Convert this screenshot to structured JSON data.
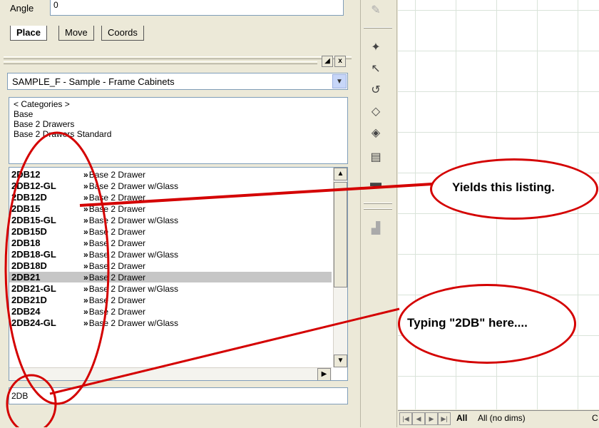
{
  "top": {
    "angle_label": "Angle",
    "angle_value": "0"
  },
  "tabs": [
    {
      "label": "Place",
      "active": true
    },
    {
      "label": "Move",
      "active": false
    },
    {
      "label": "Coords",
      "active": false
    }
  ],
  "panel_controls": {
    "pin": "◢",
    "close": "x"
  },
  "catalog": {
    "selected": "SAMPLE_F - Sample - Frame Cabinets"
  },
  "categories": [
    "< Categories >",
    "Base",
    "Base 2 Drawers",
    "Base 2 Drawers Standard"
  ],
  "list": {
    "rows": [
      {
        "code": "2DB12",
        "desc": "Base 2 Drawer"
      },
      {
        "code": "2DB12-GL",
        "desc": "Base 2 Drawer w/Glass"
      },
      {
        "code": "2DB12D",
        "desc": "Base 2 Drawer"
      },
      {
        "code": "2DB15",
        "desc": "Base 2 Drawer"
      },
      {
        "code": "2DB15-GL",
        "desc": "Base 2 Drawer w/Glass"
      },
      {
        "code": "2DB15D",
        "desc": "Base 2 Drawer"
      },
      {
        "code": "2DB18",
        "desc": "Base 2 Drawer"
      },
      {
        "code": "2DB18-GL",
        "desc": "Base 2 Drawer w/Glass"
      },
      {
        "code": "2DB18D",
        "desc": "Base 2 Drawer"
      },
      {
        "code": "2DB21",
        "desc": "Base 2 Drawer",
        "selected": true
      },
      {
        "code": "2DB21-GL",
        "desc": "Base 2 Drawer w/Glass"
      },
      {
        "code": "2DB21D",
        "desc": "Base 2 Drawer"
      },
      {
        "code": "2DB24",
        "desc": "Base 2 Drawer"
      },
      {
        "code": "2DB24-GL",
        "desc": "Base 2 Drawer w/Glass"
      }
    ]
  },
  "filter": {
    "value": "2DB"
  },
  "layout_tabs": [
    {
      "label": "All",
      "active": true
    },
    {
      "label": "All (no dims)",
      "active": false
    },
    {
      "label": "C",
      "active": false
    }
  ],
  "annotations": {
    "top": "Yields this listing.",
    "bottom": "Typing \"2DB\" here...."
  },
  "colors": {
    "annotation_red": "#d40000",
    "panel_bg": "#ece9d8",
    "selection_gray": "#c6c6c6",
    "input_border": "#7f9db9"
  }
}
